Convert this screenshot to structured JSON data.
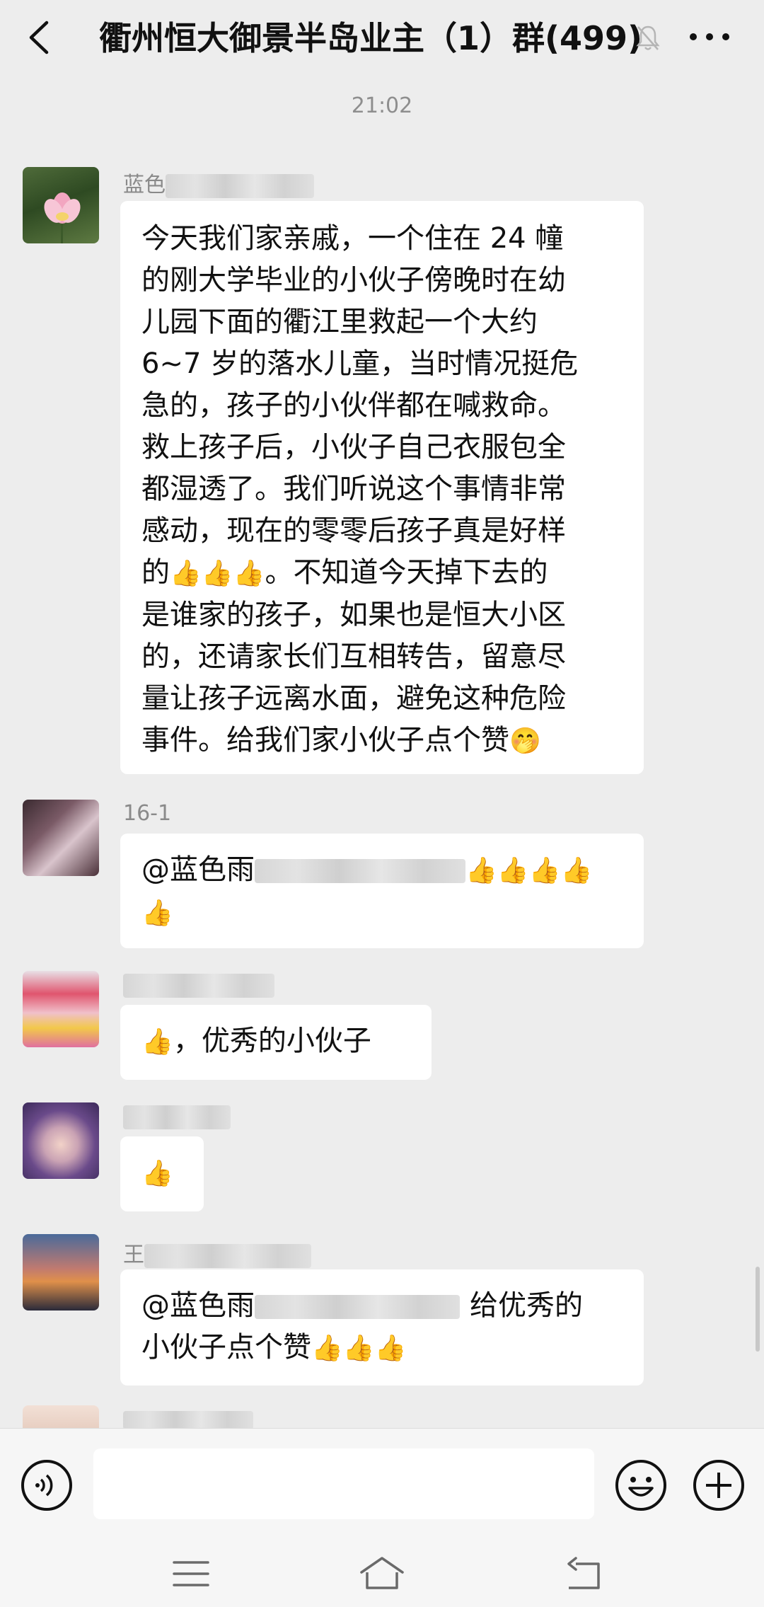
{
  "header": {
    "title": "衢州恒大御景半岛业主（1）群(499)"
  },
  "timestamp": "21:02",
  "messages": [
    {
      "sender_visible": "蓝色",
      "lines": [
        "今天我们家亲戚，一个住在 24 幢",
        "的刚大学毕业的小伙子傍晚时在幼",
        "儿园下面的衢江里救起一个大约",
        "6~7 岁的落水儿童，当时情况挺危",
        "急的，孩子的小伙伴都在喊救命。",
        "救上孩子后，小伙子自己衣服包全",
        "都湿透了。我们听说这个事情非常",
        "感动，现在的零零后孩子真是好样",
        "的",
        "。不知道今天掉下去的",
        "是谁家的孩子，如果也是恒大小区",
        "的，还请家长们互相转告，留意尽",
        "量让孩子远离水面，避免这种危险",
        "事件。给我们家小伙子点个赞"
      ]
    },
    {
      "sender_visible": "16-1",
      "mention": "@蓝色雨"
    },
    {
      "sender_visible": "",
      "text": "，优秀的小伙子"
    },
    {
      "sender_visible": ""
    },
    {
      "sender_visible": "王",
      "mention": "@蓝色雨",
      "text_a": "给优秀的",
      "text_b": "小伙子点个赞"
    }
  ],
  "emoji": {
    "thumbs_up": "👍",
    "hand_over_mouth": "🤭"
  },
  "icons": [
    "back-icon",
    "mute-icon",
    "more-icon",
    "voice-icon",
    "emoji-icon",
    "plus-icon",
    "nav-menu-icon",
    "nav-home-icon",
    "nav-back-icon"
  ]
}
